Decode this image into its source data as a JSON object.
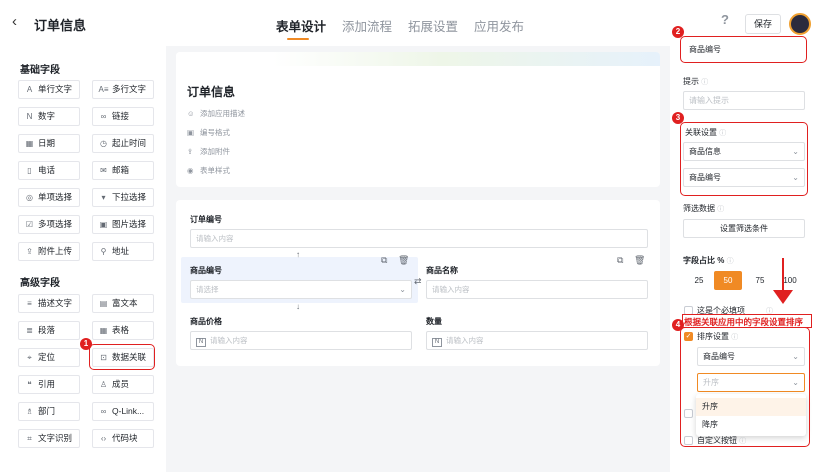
{
  "header": {
    "back_icon": "chevron-left-icon",
    "title": "订单信息",
    "tabs": [
      {
        "label": "表单设计",
        "active": true
      },
      {
        "label": "添加流程"
      },
      {
        "label": "拓展设置"
      },
      {
        "label": "应用发布"
      }
    ],
    "help_label": "?",
    "save_label": "保存"
  },
  "left_panel": {
    "basic_title": "基础字段",
    "basic_fields": [
      {
        "label": "单行文字",
        "icon": "A"
      },
      {
        "label": "多行文字",
        "icon": "A≡"
      },
      {
        "label": "数字",
        "icon": "N"
      },
      {
        "label": "链接",
        "icon": "∞"
      },
      {
        "label": "日期",
        "icon": "▦"
      },
      {
        "label": "起止时间",
        "icon": "◷"
      },
      {
        "label": "电话",
        "icon": "▯"
      },
      {
        "label": "邮箱",
        "icon": "✉"
      },
      {
        "label": "单项选择",
        "icon": "◎"
      },
      {
        "label": "下拉选择",
        "icon": "▾"
      },
      {
        "label": "多项选择",
        "icon": "☑"
      },
      {
        "label": "图片选择",
        "icon": "▣"
      },
      {
        "label": "附件上传",
        "icon": "⇪"
      },
      {
        "label": "地址",
        "icon": "⚲"
      }
    ],
    "advanced_title": "高级字段",
    "advanced_fields": [
      {
        "label": "描述文字",
        "icon": "≡"
      },
      {
        "label": "富文本",
        "icon": "▤"
      },
      {
        "label": "段落",
        "icon": "≣"
      },
      {
        "label": "表格",
        "icon": "▦"
      },
      {
        "label": "定位",
        "icon": "⌖"
      },
      {
        "label": "数据关联",
        "icon": "⊡"
      },
      {
        "label": "引用",
        "icon": "❝"
      },
      {
        "label": "成员",
        "icon": "♙"
      },
      {
        "label": "部门",
        "icon": "♗"
      },
      {
        "label": "Q-Link...",
        "icon": "∞"
      },
      {
        "label": "文字识别",
        "icon": "⌗"
      },
      {
        "label": "代码块",
        "icon": "‹›"
      }
    ]
  },
  "form": {
    "title": "订单信息",
    "meta": [
      {
        "label": "添加应用描述",
        "icon": "☺"
      },
      {
        "label": "编号格式",
        "icon": "▣"
      },
      {
        "label": "添加附件",
        "icon": "⇪"
      },
      {
        "label": "表单样式",
        "icon": "◉"
      }
    ],
    "order_no": {
      "label": "订单编号",
      "placeholder": "请输入内容"
    },
    "product_no": {
      "label": "商品编号",
      "placeholder": "请选择"
    },
    "product_name": {
      "label": "商品名称",
      "placeholder": "请输入内容"
    },
    "product_price": {
      "label": "商品价格",
      "placeholder": "请输入内容",
      "icon": "N"
    },
    "quantity": {
      "label": "数量",
      "placeholder": "请输入内容",
      "icon": "N"
    }
  },
  "right_panel": {
    "field_name": "商品编号",
    "hint_label": "提示",
    "hint_placeholder": "请输入提示",
    "relation_label": "关联设置",
    "relation_form": "商品信息",
    "relation_field": "商品编号",
    "filter_label": "筛选数据",
    "filter_button": "设置筛选条件",
    "width_label": "字段占比 %",
    "width_options": [
      "25",
      "50",
      "75",
      "100"
    ],
    "width_selected": "50",
    "required_label": "这是个必填项",
    "sort_note": "根据关联应用中的字段设置排序",
    "sort_label": "排序设置",
    "sort_checked": true,
    "sort_field": "商品编号",
    "sort_order_placeholder": "升序",
    "sort_options": [
      "升序",
      "降序"
    ],
    "custom_button_label": "自定义按钮"
  },
  "annotations": [
    "1",
    "2",
    "3",
    "4"
  ],
  "colors": {
    "accent": "#f08a24",
    "annotation_red": "#e02020"
  }
}
